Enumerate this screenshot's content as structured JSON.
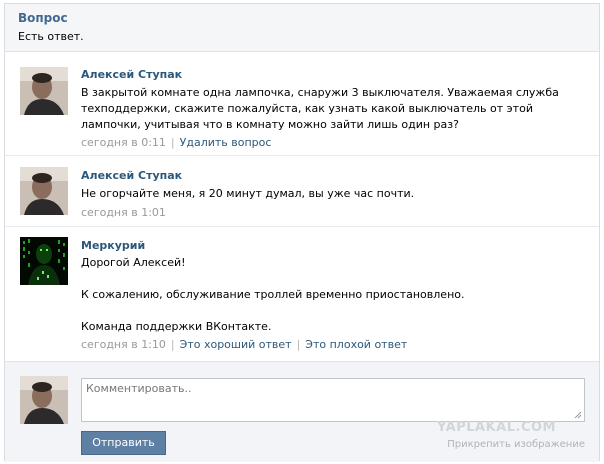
{
  "header": {
    "title": "Вопрос",
    "subtitle": "Есть ответ."
  },
  "posts": [
    {
      "author": "Алексей Ступак",
      "text": "В закрытой комнате одна лампочка, снаружи 3 выключателя. Уважаемая служба техподдержки, скажите пожалуйста, как узнать какой выключатель от этой лампочки, учитывая что в комнату можно зайти лишь один раз?",
      "time": "сегодня в 0:11",
      "action": "Удалить вопрос"
    },
    {
      "author": "Алексей Ступак",
      "text": "Не огорчайте меня, я 20 минут думал, вы уже час почти.",
      "time": "сегодня в 1:01"
    },
    {
      "author": "Меркурий",
      "line1": "Дорогой Алексей!",
      "line2": "К сожалению, обслуживание троллей временно приостановлено.",
      "line3": "Команда поддержки ВКонтакте.",
      "time": "сегодня в 1:10",
      "good": "Это хороший ответ",
      "bad": "Это плохой ответ"
    }
  ],
  "footer": {
    "placeholder": "Комментировать..",
    "send": "Отправить",
    "attach": "Прикрепить изображение"
  },
  "watermark": "YAPLAKAL.COM",
  "icons": {
    "avatar_user": "user-photo",
    "avatar_support": "matrix-logo",
    "resize": "resize-grip-icon"
  },
  "colors": {
    "accent": "#45688e",
    "link": "#2b587a",
    "muted": "#999999",
    "button": "#5e80a4"
  }
}
